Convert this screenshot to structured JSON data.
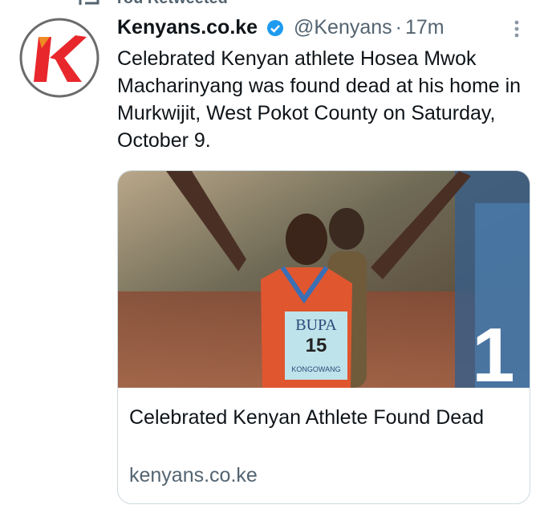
{
  "retweet": {
    "label": "You Retweeted"
  },
  "tweet": {
    "display_name": "Kenyans.co.ke",
    "handle": "@Kenyans",
    "separator": "·",
    "time": "17m",
    "text": "Celebrated Kenyan athlete Hosea Mwok Macharinyang was found dead at his home in Murkwijit, West Pokot County on Saturday, October 9."
  },
  "card": {
    "title": "Celebrated Kenyan Athlete Found Dead",
    "domain": "kenyans.co.ke",
    "image": {
      "bib_sponsor": "BUPA",
      "bib_number": "15",
      "bib_bottom_text": "KONGOWANG",
      "place_number": "1"
    }
  },
  "icons": [
    "retweet-icon",
    "verified-badge-icon",
    "more-options-icon",
    "kenyans-logo"
  ],
  "colors": {
    "verified_blue": "#1d9bf0",
    "logo_red": "#e8272c",
    "secondary_text": "#536471",
    "card_border": "#cfd9de"
  }
}
